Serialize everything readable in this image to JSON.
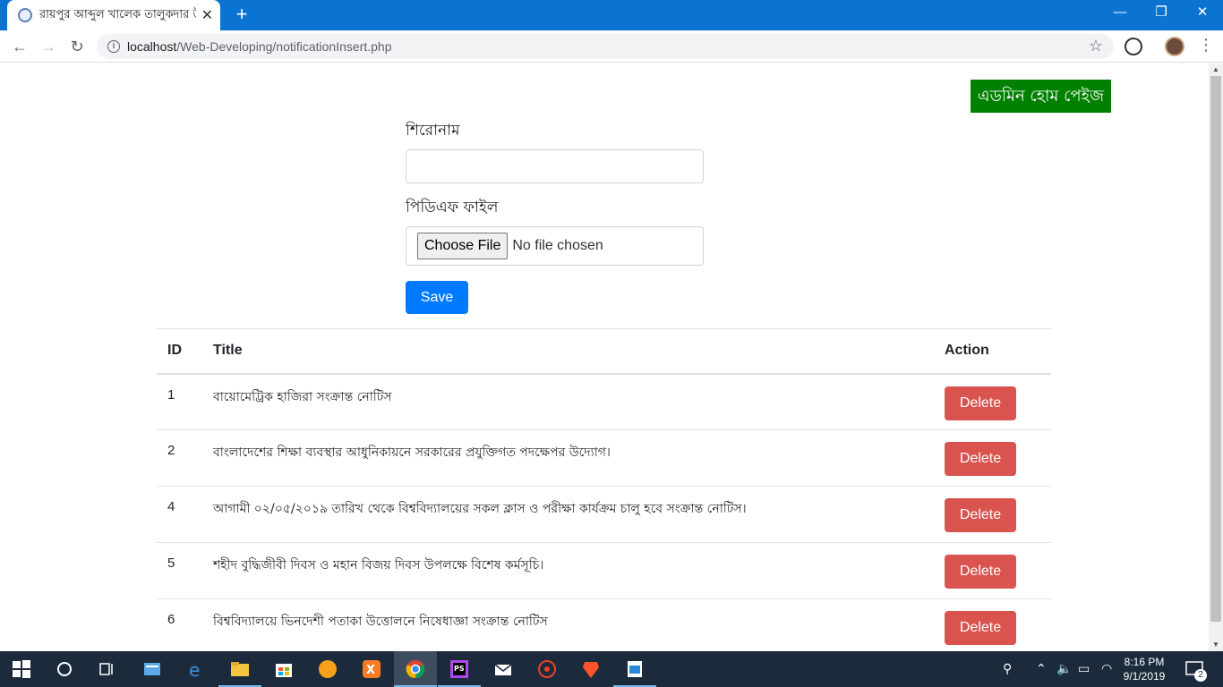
{
  "browser": {
    "tab_title": "রায়পুর আব্দুল খালেক তালুকদার উ",
    "url_host": "localhost",
    "url_path": "/Web-Developing/notificationInsert.php"
  },
  "page": {
    "admin_home_label": "এডমিন হোম পেইজ",
    "title_label": "শিরোনাম",
    "pdf_label": "পিডিএফ ফাইল",
    "choose_file_label": "Choose File",
    "no_file_text": "No file chosen",
    "save_label": "Save",
    "table": {
      "headers": [
        "ID",
        "Title",
        "Action"
      ],
      "rows": [
        {
          "id": "1",
          "title": "বায়োমেট্রিক হাজিরা সংক্রান্ত নোটিস",
          "action": "Delete"
        },
        {
          "id": "2",
          "title": "বাংলাদেশের শিক্ষা ব্যবস্থার আধুনিকায়নে সরকারের প্রযুক্তিগত পদক্ষেপর উদ্যোগ।",
          "action": "Delete"
        },
        {
          "id": "4",
          "title": "আগামী ০২/০৫/২০১৯ তারিখ থেকে বিশ্ববিদ্যালয়ের সকল ক্লাস ও পরীক্ষা কার্যক্রম চালু হবে সংক্রান্ত নোটিস।",
          "action": "Delete"
        },
        {
          "id": "5",
          "title": "শহীদ বুদ্ধিজীবী দিবস ও মহান বিজয় দিবস উপলক্ষে বিশেষ কর্মসূচি।",
          "action": "Delete"
        },
        {
          "id": "6",
          "title": "বিশ্ববিদ্যালয়ে ভিনদেশী পতাকা উত্তোলনে নিষেধাজ্ঞা সংক্রান্ত নোটিস",
          "action": "Delete"
        }
      ]
    }
  },
  "taskbar": {
    "time": "8:16 PM",
    "date": "9/1/2019",
    "notification_count": "2"
  },
  "colors": {
    "tab_strip": "#0b73d1",
    "admin_button": "#008000",
    "save_button": "#007bff",
    "delete_button": "#d9534f",
    "taskbar": "#1c2b3c"
  }
}
